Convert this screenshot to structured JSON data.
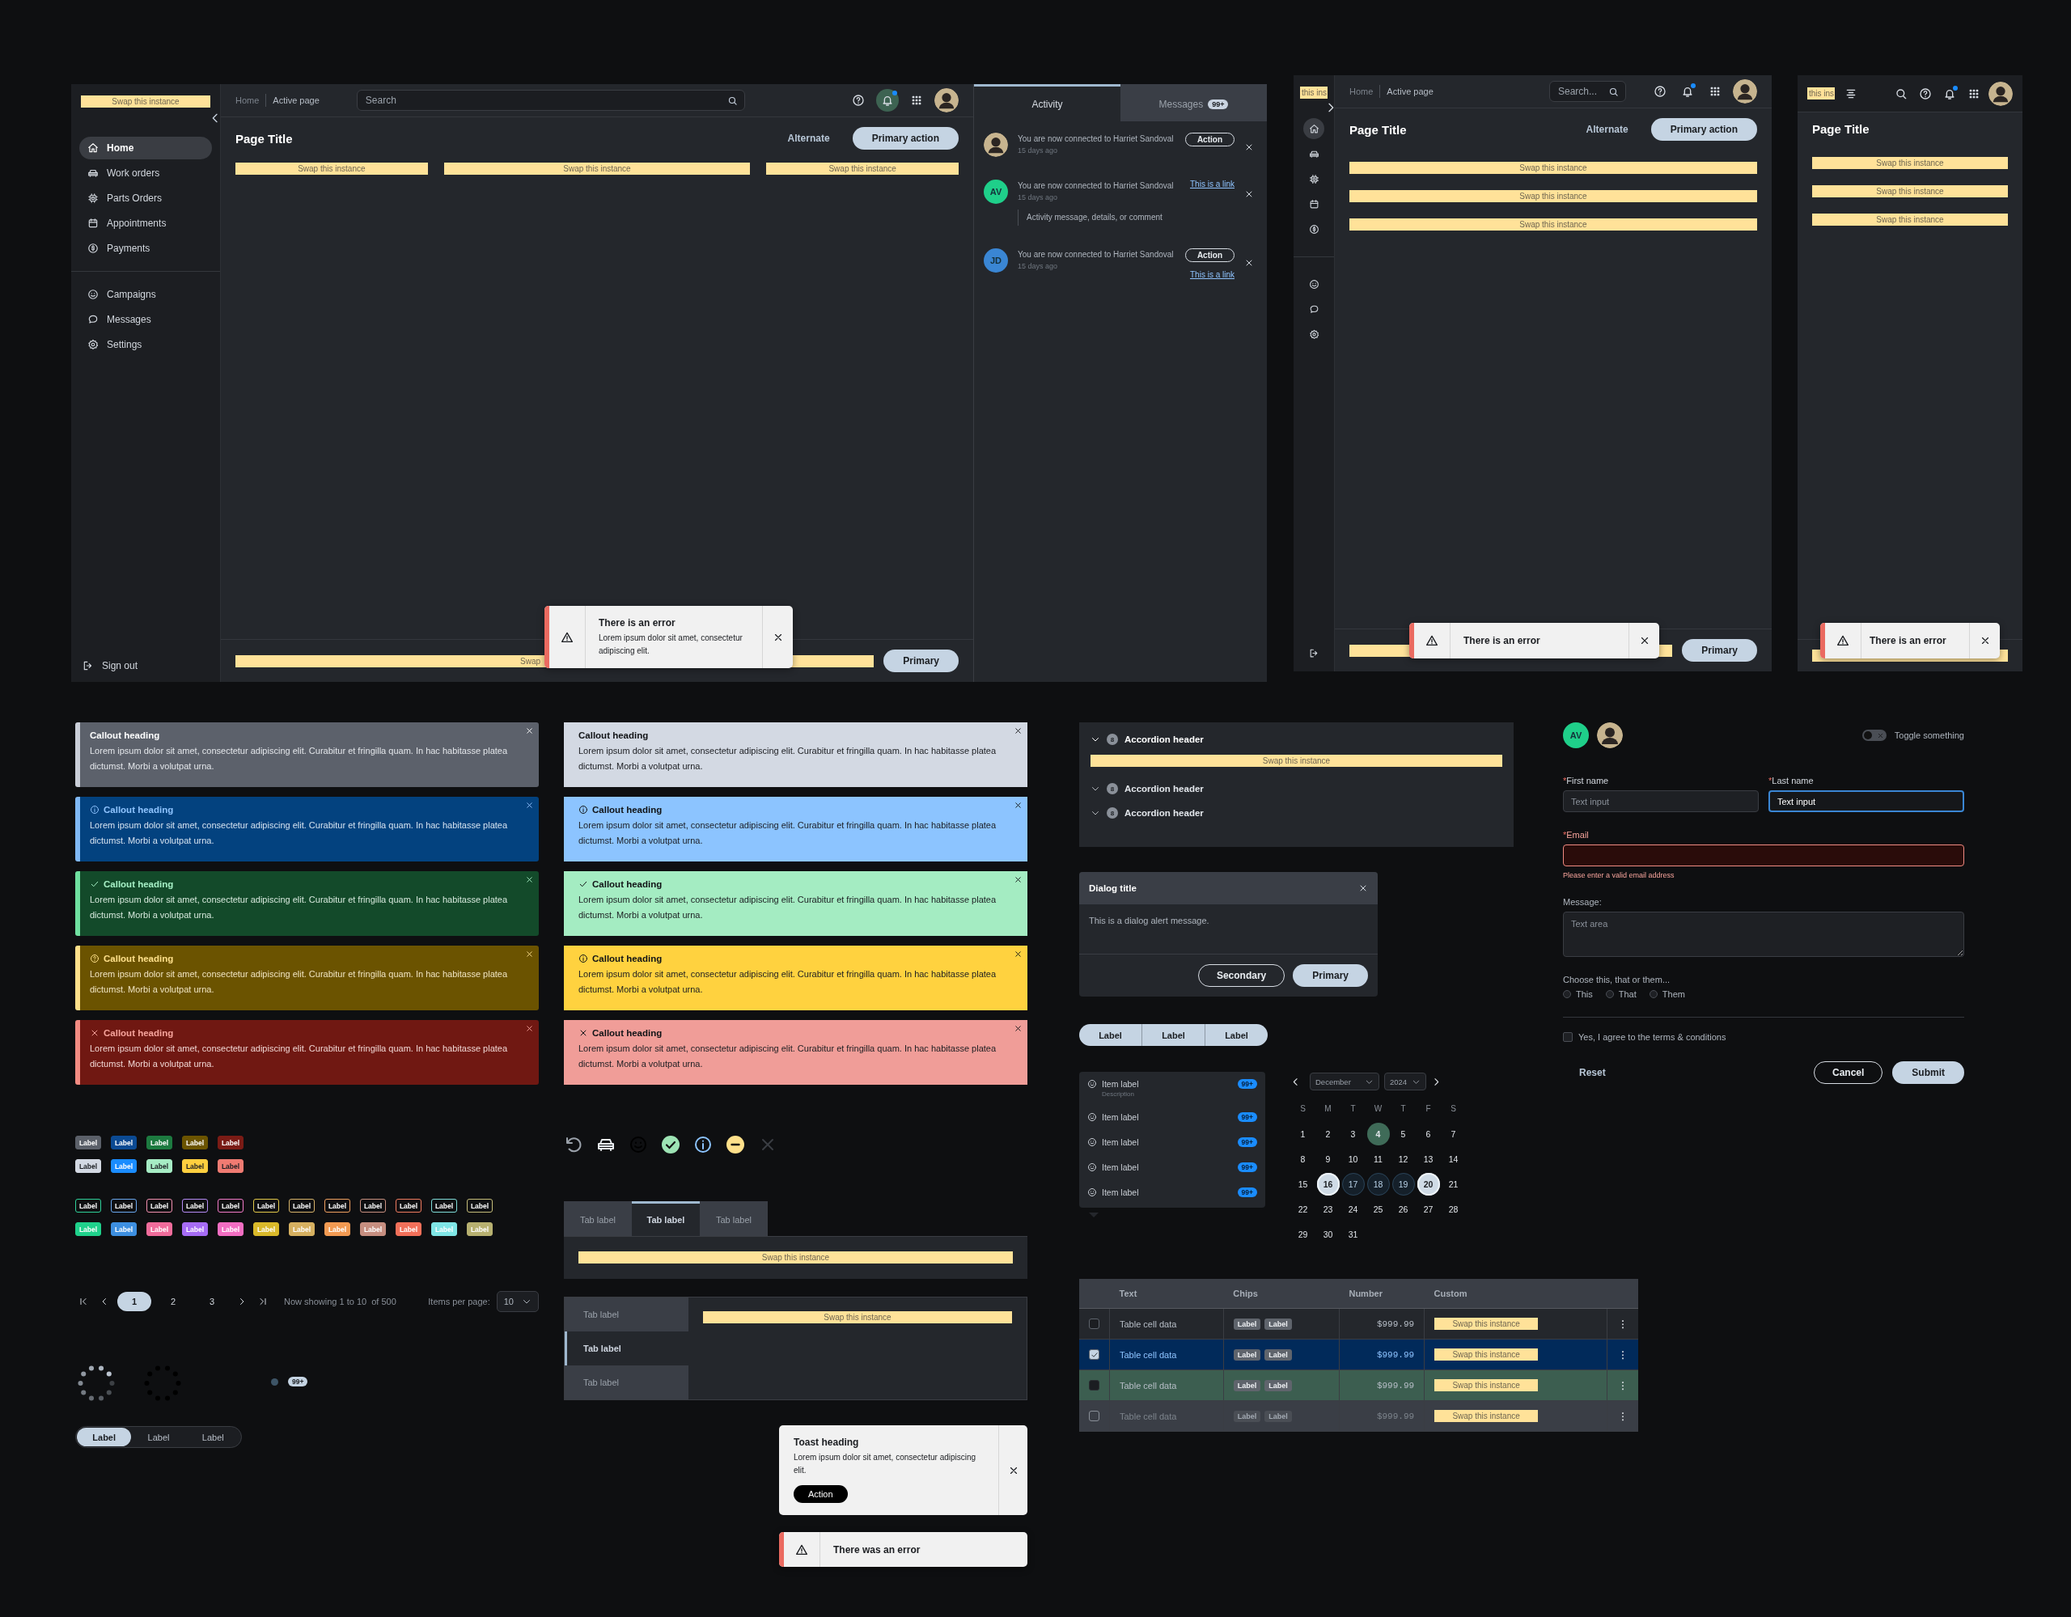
{
  "desktop_app": {
    "sidebar": {
      "logo_placeholder": "Swap this instance",
      "items": [
        {
          "label": "Home",
          "selected": true
        },
        {
          "label": "Work orders",
          "selected": false
        },
        {
          "label": "Parts Orders",
          "selected": false
        },
        {
          "label": "Appointments",
          "selected": false
        },
        {
          "label": "Payments",
          "selected": false
        }
      ],
      "secondary_items": [
        {
          "label": "Campaigns",
          "selected": false
        },
        {
          "label": "Messages",
          "selected": false
        },
        {
          "label": "Settings",
          "selected": false
        }
      ],
      "sign_out": "Sign out"
    },
    "breadcrumbs": [
      "Home",
      "Active page"
    ],
    "search": {
      "placeholder": "Search"
    },
    "notifications": {
      "unread": true
    },
    "page_title": "Page Title",
    "alternate_button": "Alternate",
    "primary_button": "Primary action",
    "placeholders": [
      "Swap this instance",
      "Swap this instance",
      "Swap this instance"
    ],
    "footer_placeholder": "Swap",
    "footer_button": "Primary",
    "toast": {
      "title": "There is an error",
      "message": "Lorem ipsum dolor sit amet, consectetur adipiscing elit."
    },
    "panel": {
      "tabs": [
        {
          "label": "Activity",
          "selected": true
        },
        {
          "label": "Messages",
          "badge": "99+",
          "selected": false
        }
      ],
      "activities": [
        {
          "avatar": {
            "kind": "photo"
          },
          "message": "You are now connected to Harriet Sandoval",
          "time": "15 days ago",
          "actions": [
            {
              "kind": "button",
              "label": "Action"
            }
          ]
        },
        {
          "avatar": {
            "kind": "initials",
            "initials": "AV",
            "color": "#1fcf8a"
          },
          "message": "You are now connected to Harriet Sandoval",
          "time": "15 days ago",
          "actions": [
            {
              "kind": "link",
              "label": "This is a link"
            }
          ],
          "comment": "Activity message, details, or comment"
        },
        {
          "avatar": {
            "kind": "initials",
            "initials": "JD",
            "color": "#3a86d4"
          },
          "message": "You are now connected to Harriet Sandoval",
          "time": "15 days ago",
          "actions": [
            {
              "kind": "button",
              "label": "Action"
            },
            {
              "kind": "link",
              "label": "This is a link"
            }
          ]
        }
      ]
    }
  },
  "tablet_app": {
    "logo_placeholder": "this ins",
    "rail_items": [
      {
        "selected": true
      },
      {
        "selected": false
      },
      {
        "selected": false
      },
      {
        "selected": false
      },
      {
        "selected": false
      }
    ],
    "rail_secondary_items": [
      {
        "selected": false
      },
      {
        "selected": false
      },
      {
        "selected": false
      }
    ],
    "breadcrumbs": [
      "Home",
      "Active page"
    ],
    "search": {
      "placeholder": "Search..."
    },
    "notifications": {
      "unread": true
    },
    "page_title": "Page Title",
    "alternate_button": "Alternate",
    "primary_button": "Primary action",
    "placeholders": [
      "Swap this instance",
      "Swap this instance",
      "Swap this instance"
    ],
    "toast": {
      "title": "There is an error"
    },
    "footer_button": "Primary"
  },
  "mobile_app": {
    "logo_placeholder": "this ins",
    "notifications": {
      "unread": true
    },
    "page_title": "Page Title",
    "placeholders": [
      "Swap this instance",
      "Swap this instance",
      "Swap this instance"
    ],
    "toast": {
      "title": "There is an error"
    }
  },
  "callout_columns": [
    {
      "callouts": [
        {
          "kind": "neutral",
          "heading": "Callout heading",
          "body": "Lorem ipsum dolor sit amet, consectetur adipiscing elit. Curabitur et fringilla quam. In hac habitasse platea dictumst. Morbi a volutpat urna."
        },
        {
          "kind": "info",
          "heading": "Callout heading",
          "body": "Lorem ipsum dolor sit amet, consectetur adipiscing elit. Curabitur et fringilla quam. In hac habitasse platea dictumst. Morbi a volutpat urna."
        },
        {
          "kind": "success",
          "heading": "Callout heading",
          "body": "Lorem ipsum dolor sit amet, consectetur adipiscing elit. Curabitur et fringilla quam. In hac habitasse platea dictumst. Morbi a volutpat urna."
        },
        {
          "kind": "warning",
          "heading": "Callout heading",
          "body": "Lorem ipsum dolor sit amet, consectetur adipiscing elit. Curabitur et fringilla quam. In hac habitasse platea dictumst. Morbi a volutpat urna."
        },
        {
          "kind": "error",
          "heading": "Callout heading",
          "body": "Lorem ipsum dolor sit amet, consectetur adipiscing elit. Curabitur et fringilla quam. In hac habitasse platea dictumst. Morbi a volutpat urna."
        }
      ]
    },
    {
      "callouts": [
        {
          "kind": "neutral",
          "heading": "Callout heading",
          "body": "Lorem ipsum dolor sit amet, consectetur adipiscing elit. Curabitur et fringilla quam. In hac habitasse platea dictumst. Morbi a volutpat urna."
        },
        {
          "kind": "info",
          "heading": "Callout heading",
          "body": "Lorem ipsum dolor sit amet, consectetur adipiscing elit. Curabitur et fringilla quam. In hac habitasse platea dictumst. Morbi a volutpat urna."
        },
        {
          "kind": "success",
          "heading": "Callout heading",
          "body": "Lorem ipsum dolor sit amet, consectetur adipiscing elit. Curabitur et fringilla quam. In hac habitasse platea dictumst. Morbi a volutpat urna."
        },
        {
          "kind": "warning",
          "heading": "Callout heading",
          "body": "Lorem ipsum dolor sit amet, consectetur adipiscing elit. Curabitur et fringilla quam. In hac habitasse platea dictumst. Morbi a volutpat urna."
        },
        {
          "kind": "error",
          "heading": "Callout heading",
          "body": "Lorem ipsum dolor sit amet, consectetur adipiscing elit. Curabitur et fringilla quam. In hac habitasse platea dictumst. Morbi a volutpat urna."
        }
      ]
    }
  ],
  "accordion": [
    {
      "count": "8",
      "title": "Accordion header",
      "expanded": true,
      "content": "Swap this instance"
    },
    {
      "count": "8",
      "title": "Accordion header",
      "expanded": false
    },
    {
      "count": "8",
      "title": "Accordion header",
      "expanded": false
    }
  ],
  "dialog": {
    "title": "Dialog title",
    "message": "This is a dialog alert message.",
    "secondary_button": "Secondary",
    "primary_button": "Primary"
  },
  "button_group": [
    "Label",
    "Label",
    "Label"
  ],
  "item_list": [
    {
      "label": "Item label",
      "description": "Description",
      "badge": "99+"
    },
    {
      "label": "Item label",
      "badge": "99+"
    },
    {
      "label": "Item label",
      "badge": "99+"
    },
    {
      "label": "Item label",
      "badge": "99+"
    },
    {
      "label": "Item label",
      "badge": "99+"
    }
  ],
  "calendar": {
    "month": "December",
    "year": "2024",
    "weekdays": [
      "S",
      "M",
      "T",
      "W",
      "T",
      "F",
      "S"
    ],
    "days": [
      {
        "label": "1",
        "selected": false,
        "in_range": false,
        "today": false
      },
      {
        "label": "2",
        "selected": false,
        "in_range": false,
        "today": false
      },
      {
        "label": "3",
        "selected": false,
        "in_range": false,
        "today": false
      },
      {
        "label": "4",
        "selected": false,
        "in_range": false,
        "today": true
      },
      {
        "label": "5",
        "selected": false,
        "in_range": false,
        "today": false
      },
      {
        "label": "6",
        "selected": false,
        "in_range": false,
        "today": false
      },
      {
        "label": "7",
        "selected": false,
        "in_range": false,
        "today": false
      },
      {
        "label": "8",
        "selected": false,
        "in_range": false,
        "today": false
      },
      {
        "label": "9",
        "selected": false,
        "in_range": false,
        "today": false
      },
      {
        "label": "10",
        "selected": false,
        "in_range": false,
        "today": false
      },
      {
        "label": "11",
        "selected": false,
        "in_range": false,
        "today": false
      },
      {
        "label": "12",
        "selected": false,
        "in_range": false,
        "today": false
      },
      {
        "label": "13",
        "selected": false,
        "in_range": false,
        "today": false
      },
      {
        "label": "14",
        "selected": false,
        "in_range": false,
        "today": false
      },
      {
        "label": "15",
        "selected": false,
        "in_range": false,
        "today": false
      },
      {
        "label": "16",
        "selected": true,
        "in_range": false,
        "today": false
      },
      {
        "label": "17",
        "selected": false,
        "in_range": true,
        "today": false
      },
      {
        "label": "18",
        "selected": false,
        "in_range": true,
        "today": false
      },
      {
        "label": "19",
        "selected": false,
        "in_range": true,
        "today": false
      },
      {
        "label": "20",
        "selected": true,
        "in_range": false,
        "today": false
      },
      {
        "label": "21",
        "selected": false,
        "in_range": false,
        "today": false
      },
      {
        "label": "22",
        "selected": false,
        "in_range": false,
        "today": false
      },
      {
        "label": "23",
        "selected": false,
        "in_range": false,
        "today": false
      },
      {
        "label": "24",
        "selected": false,
        "in_range": false,
        "today": false
      },
      {
        "label": "25",
        "selected": false,
        "in_range": false,
        "today": false
      },
      {
        "label": "26",
        "selected": false,
        "in_range": false,
        "today": false
      },
      {
        "label": "27",
        "selected": false,
        "in_range": false,
        "today": false
      },
      {
        "label": "28",
        "selected": false,
        "in_range": false,
        "today": false
      },
      {
        "label": "29",
        "selected": false,
        "in_range": false,
        "today": false
      },
      {
        "label": "30",
        "selected": false,
        "in_range": false,
        "today": false
      },
      {
        "label": "31",
        "selected": false,
        "in_range": false,
        "today": false
      }
    ]
  },
  "table": {
    "columns": [
      "Text",
      "Chips",
      "Number",
      "Custom"
    ],
    "rows": [
      {
        "checked": false,
        "selected": false,
        "highlighted": false,
        "disabled": false,
        "text": "Table cell data",
        "chips": [
          "Label",
          "Label"
        ],
        "number": "$999.99",
        "custom": "Swap this instance"
      },
      {
        "checked": true,
        "selected": true,
        "highlighted": false,
        "disabled": false,
        "text": "Table cell data",
        "chips": [
          "Label",
          "Label"
        ],
        "number": "$999.99",
        "custom": "Swap this instance"
      },
      {
        "checked": false,
        "selected": false,
        "highlighted": true,
        "disabled": false,
        "text": "Table cell data",
        "chips": [
          "Label",
          "Label"
        ],
        "number": "$999.99",
        "custom": "Swap this instance"
      },
      {
        "checked": false,
        "selected": false,
        "highlighted": false,
        "disabled": true,
        "text": "Table cell data",
        "chips": [
          "Label",
          "Label"
        ],
        "number": "$999.99",
        "custom": "Swap this instance"
      }
    ]
  },
  "form": {
    "avatars": [
      {
        "kind": "initials",
        "initials": "AV",
        "color": "#1fcf8a"
      },
      {
        "kind": "photo"
      }
    ],
    "toggle": {
      "label": "Toggle something",
      "on": false
    },
    "first_name": {
      "label": "First name",
      "required_mark": "*",
      "placeholder": "Text input",
      "focused": false
    },
    "last_name": {
      "label": "Last name",
      "required_mark": "*",
      "value": "Text input",
      "focused": true
    },
    "email": {
      "label": "Email",
      "required_mark": "*",
      "error": "Please enter a valid email address"
    },
    "message": {
      "label": "Message:",
      "placeholder": "Text area"
    },
    "choice": {
      "label": "Choose this, that or them...",
      "options": [
        {
          "label": "This",
          "selected": false
        },
        {
          "label": "That",
          "selected": false
        },
        {
          "label": "Them",
          "selected": false
        }
      ]
    },
    "agree": {
      "label": "Yes, I agree to the terms & conditions",
      "checked": false
    },
    "reset_button": "Reset",
    "cancel_button": "Cancel",
    "submit_button": "Submit"
  },
  "tag_rows": [
    {
      "tags": [
        {
          "label": "Label",
          "color": "#5b6069"
        },
        {
          "label": "Label",
          "color": "#0b4a93"
        },
        {
          "label": "Label",
          "color": "#1d7a40"
        },
        {
          "label": "Label",
          "color": "#6b5400"
        },
        {
          "label": "Label",
          "color": "#7a1b15"
        }
      ]
    },
    {
      "tags": [
        {
          "label": "Label",
          "color": "#d3d9e3"
        },
        {
          "label": "Label",
          "color": "#1a8cff"
        },
        {
          "label": "Label",
          "color": "#a6ecc4"
        },
        {
          "label": "Label",
          "color": "#ffcf3f"
        },
        {
          "label": "Label",
          "color": "#f07b72"
        }
      ]
    },
    {
      "tags": [
        {
          "label": "Label",
          "color": "#2fd19a"
        },
        {
          "label": "Label",
          "color": "#6aa8f0"
        },
        {
          "label": "Label",
          "color": "#f28fb0"
        },
        {
          "label": "Label",
          "color": "#b58bf5"
        },
        {
          "label": "Label",
          "color": "#f27ac8"
        },
        {
          "label": "Label",
          "color": "#e3c94a"
        },
        {
          "label": "Label",
          "color": "#d8b46a"
        },
        {
          "label": "Label",
          "color": "#f0a060"
        },
        {
          "label": "Label",
          "color": "#c99080"
        },
        {
          "label": "Label",
          "color": "#f07b60"
        },
        {
          "label": "Label",
          "color": "#7fdcd8"
        },
        {
          "label": "Label",
          "color": "#c5bd7a"
        }
      ]
    },
    {
      "tags": [
        {
          "label": "Label",
          "color": "#1fd18b"
        },
        {
          "label": "Label",
          "color": "#3d8fe0"
        },
        {
          "label": "Label",
          "color": "#f06c9b"
        },
        {
          "label": "Label",
          "color": "#a66cf5"
        },
        {
          "label": "Label",
          "color": "#f26ec2"
        },
        {
          "label": "Label",
          "color": "#d9b92a"
        },
        {
          "label": "Label",
          "color": "#d6b060"
        },
        {
          "label": "Label",
          "color": "#f29a52"
        },
        {
          "label": "Label",
          "color": "#c68e80"
        },
        {
          "label": "Label",
          "color": "#f2705a"
        },
        {
          "label": "Label",
          "color": "#7fe6e6"
        },
        {
          "label": "Label",
          "color": "#b7b070"
        }
      ]
    }
  ],
  "tabs_horizontal": {
    "tabs": [
      {
        "label": "Tab label",
        "selected": false
      },
      {
        "label": "Tab label",
        "selected": true
      },
      {
        "label": "Tab label",
        "selected": false
      }
    ],
    "content": "Swap this instance"
  },
  "tabs_vertical": {
    "tabs": [
      {
        "label": "Tab label",
        "selected": false
      },
      {
        "label": "Tab label",
        "selected": true
      },
      {
        "label": "Tab label",
        "selected": false
      }
    ],
    "content": "Swap this instance"
  },
  "pagination": {
    "pages": [
      {
        "label": "1",
        "selected": true
      },
      {
        "label": "2",
        "selected": false
      },
      {
        "label": "3",
        "selected": false
      }
    ],
    "summary": "Now showing 1 to 10  of 500",
    "items_per_page_label": "Items per page:",
    "items_per_page": "10"
  },
  "badge": "99+",
  "segmented_control": [
    {
      "label": "Label",
      "selected": true
    },
    {
      "label": "Label",
      "selected": false
    },
    {
      "label": "Label",
      "selected": false
    }
  ],
  "toast": {
    "heading": "Toast heading",
    "message": "Lorem ipsum dolor sit amet, consectetur adipiscing elit.",
    "action": "Action"
  },
  "error_toast": {
    "title": "There was an error"
  }
}
